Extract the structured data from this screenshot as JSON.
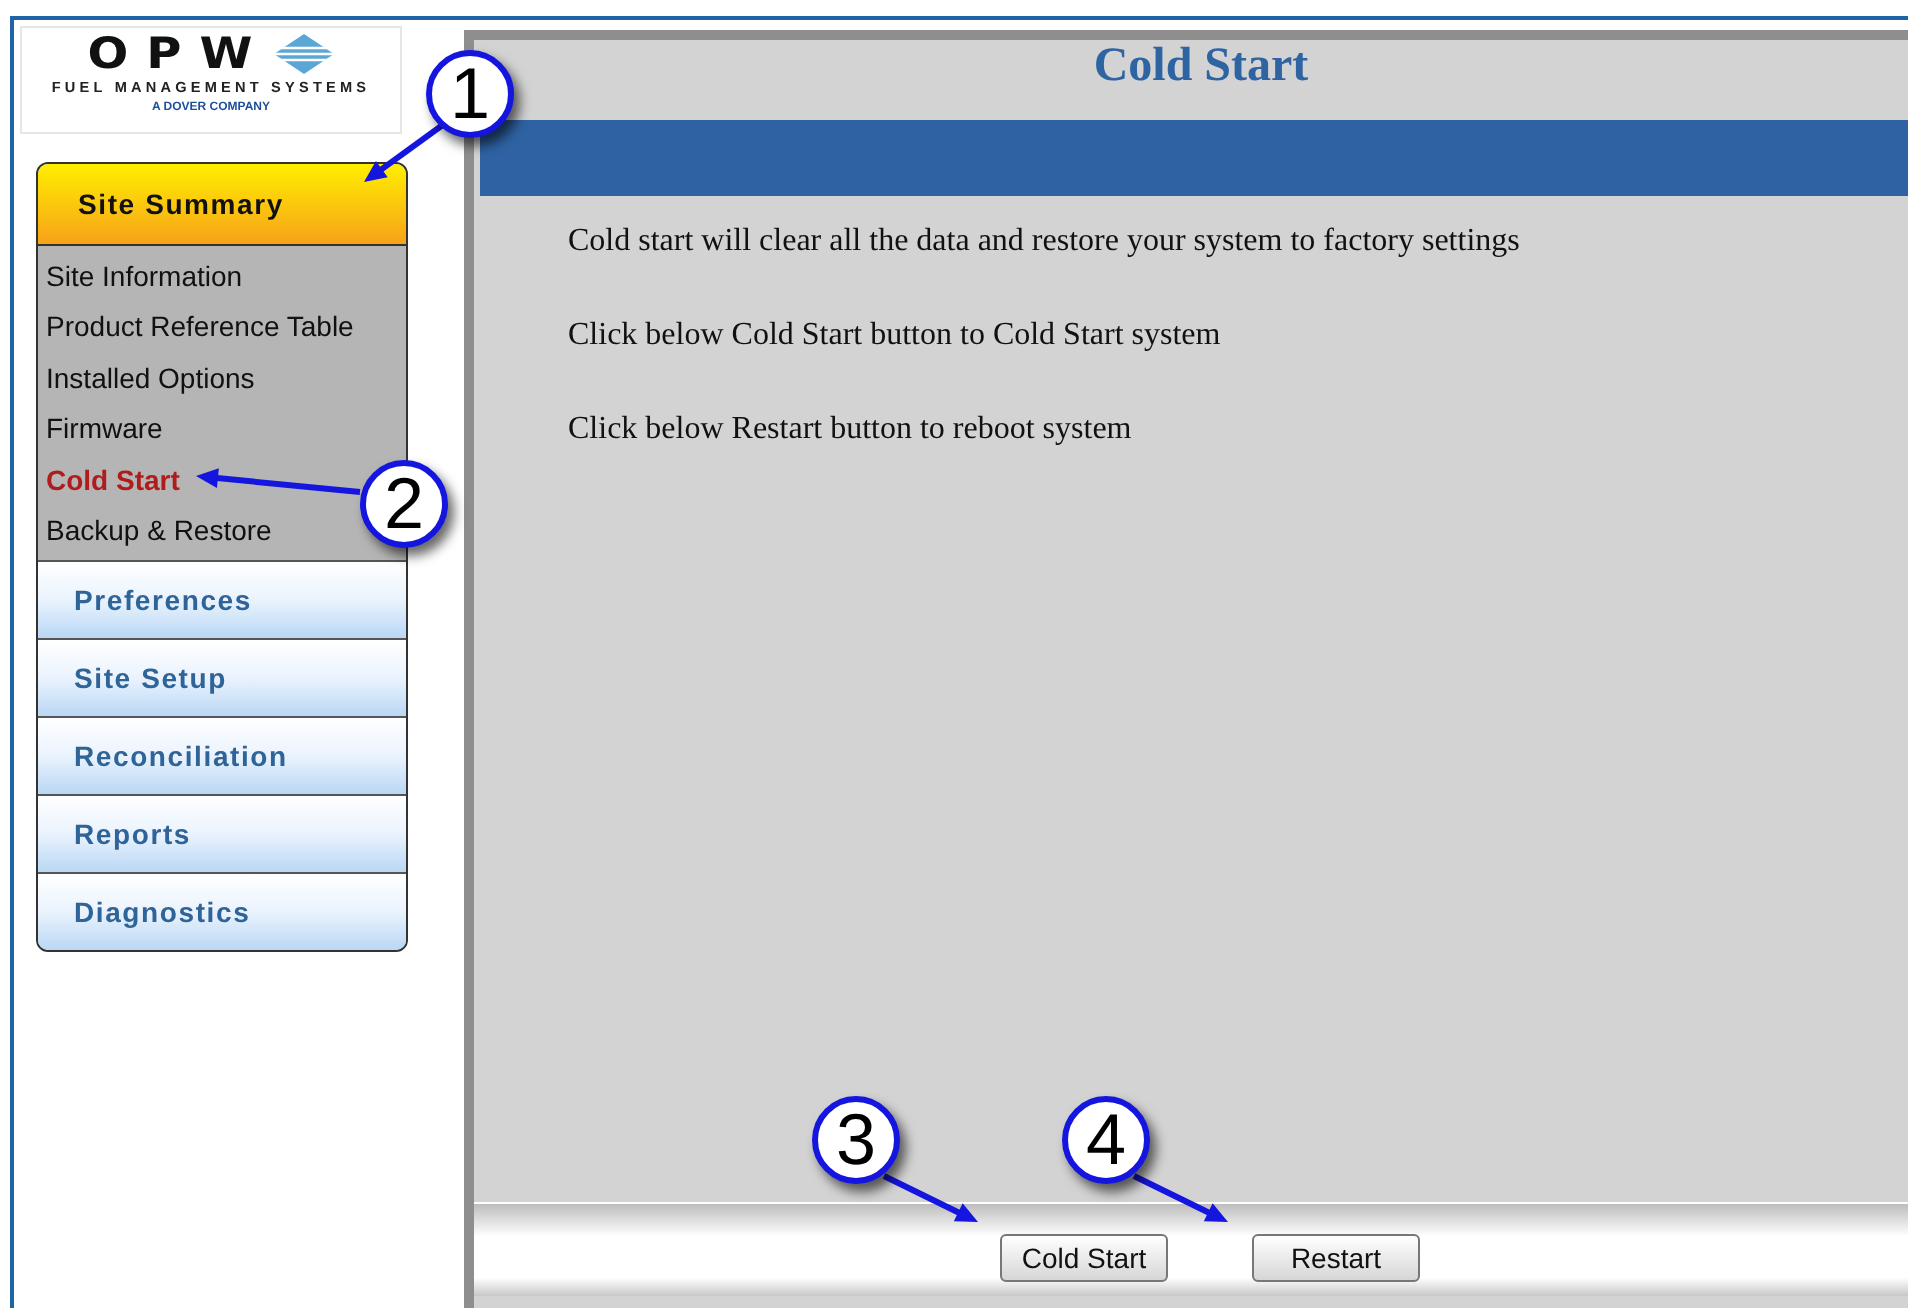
{
  "logo": {
    "wordmark": "OPW",
    "tagline": "FUEL MANAGEMENT SYSTEMS",
    "parent": "A DOVER COMPANY"
  },
  "sidebar": {
    "sections": [
      {
        "label": "Site Summary",
        "expanded": true,
        "items": [
          {
            "label": "Site Information",
            "selected": false
          },
          {
            "label": "Product Reference Table",
            "selected": false
          },
          {
            "label": "Installed Options",
            "selected": false
          },
          {
            "label": "Firmware",
            "selected": false
          },
          {
            "label": "Cold Start",
            "selected": true
          },
          {
            "label": "Backup & Restore",
            "selected": false
          }
        ]
      },
      {
        "label": "Preferences",
        "expanded": false
      },
      {
        "label": "Site Setup",
        "expanded": false
      },
      {
        "label": "Reconciliation",
        "expanded": false
      },
      {
        "label": "Reports",
        "expanded": false
      },
      {
        "label": "Diagnostics",
        "expanded": false
      }
    ]
  },
  "page": {
    "title": "Cold Start",
    "lines": [
      "Cold start will clear all the data and restore your system to factory settings",
      "Click below Cold Start button to Cold Start system",
      "Click below Restart button to reboot system"
    ]
  },
  "buttons": [
    "Cold Start",
    "Restart"
  ],
  "callouts": [
    "1",
    "2",
    "3",
    "4"
  ]
}
